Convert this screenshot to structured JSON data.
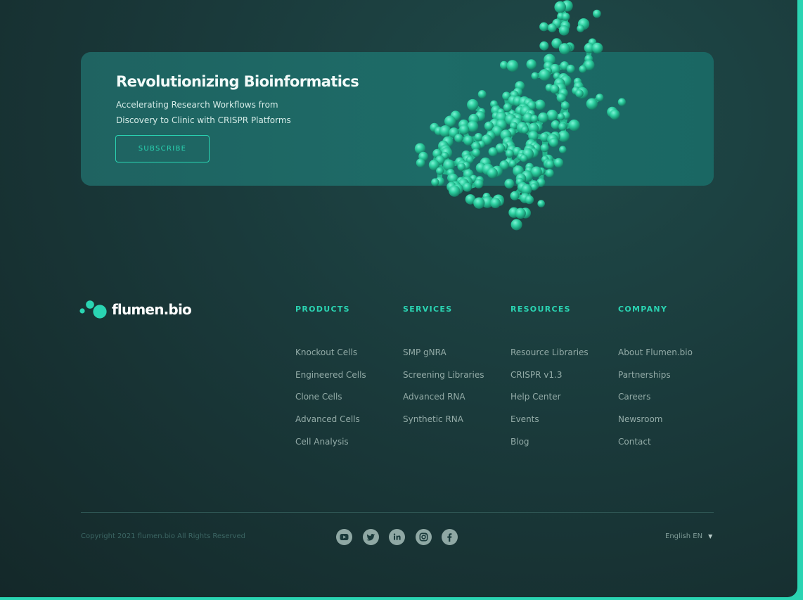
{
  "banner": {
    "title": "Revolutionizing Bioinformatics",
    "subtitle_line1": "Accelerating Research Workflows from",
    "subtitle_line2": "Discovery to Clinic with CRISPR Platforms",
    "subscribe_label": "SUBSCRIBE"
  },
  "brand": {
    "name": "flumen.bio",
    "accent_color": "#2ad4b2"
  },
  "footer": {
    "columns": [
      {
        "heading": "PRODUCTS",
        "links": [
          "Knockout Cells",
          "Engineered Cells",
          "Clone Cells",
          "Advanced Cells",
          "Cell Analysis"
        ]
      },
      {
        "heading": "SERVICES",
        "links": [
          "SMP gNRA",
          "Screening Libraries",
          "Advanced RNA",
          "Synthetic RNA"
        ]
      },
      {
        "heading": "RESOURCES",
        "links": [
          "Resource Libraries",
          "CRISPR v1.3",
          "Help Center",
          "Events",
          "Blog"
        ]
      },
      {
        "heading": "COMPANY",
        "links": [
          "About Flumen.bio",
          "Partnerships",
          "Careers",
          "Newsroom",
          "Contact"
        ]
      }
    ],
    "copyright": "Copyright 2021 flumen.bio All Rights Reserved",
    "socials": [
      "youtube-icon",
      "twitter-icon",
      "linkedin-icon",
      "instagram-icon",
      "facebook-icon"
    ],
    "language": "English EN"
  }
}
